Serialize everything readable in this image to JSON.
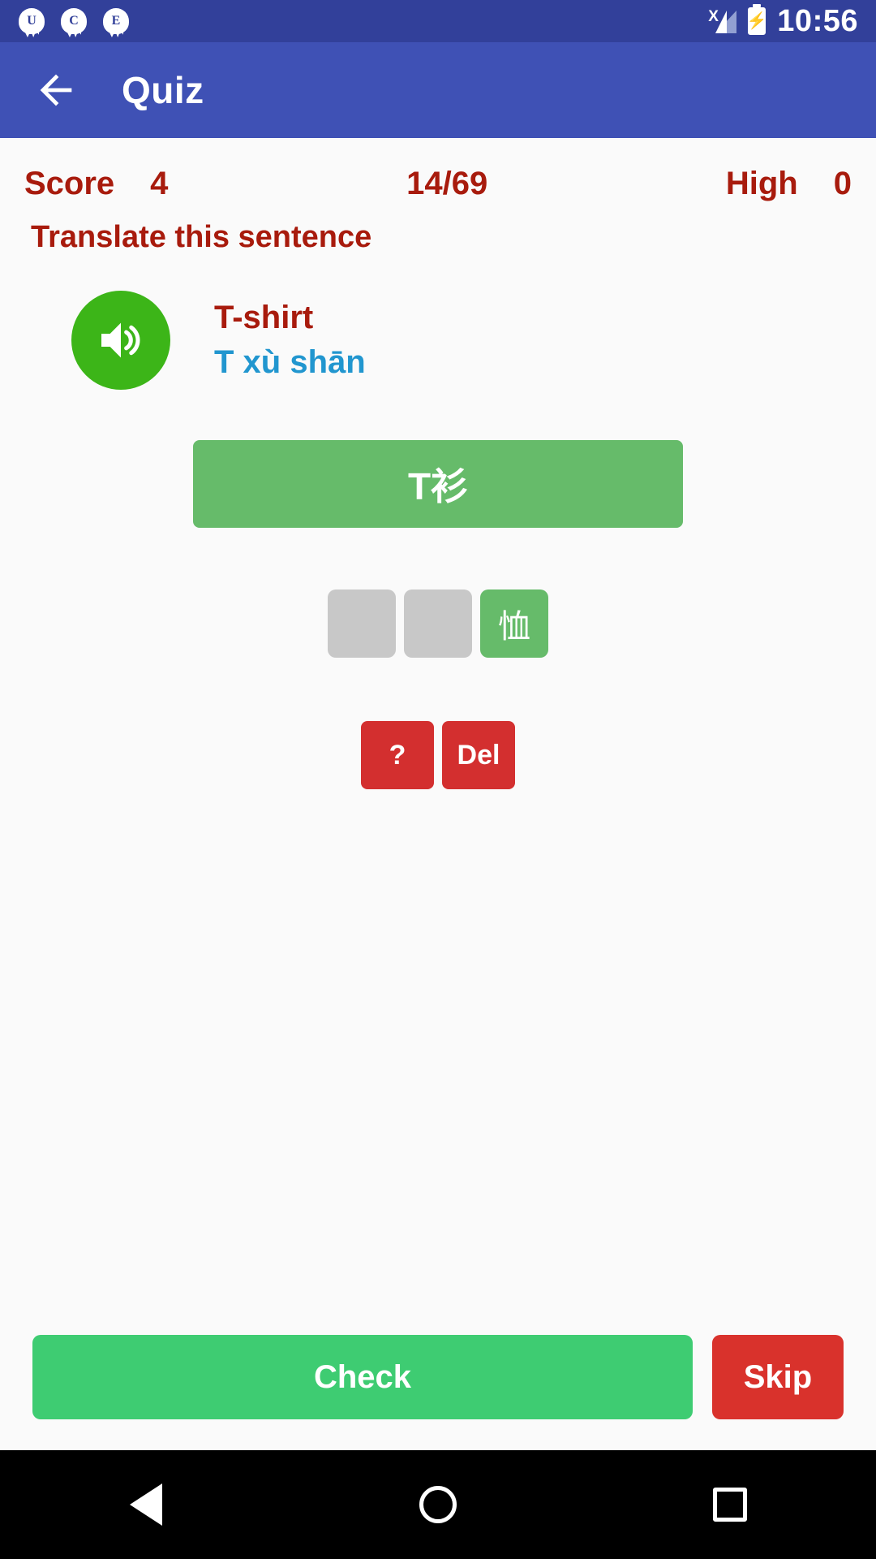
{
  "statusbar": {
    "notifications": [
      {
        "icon": "notification-bubble-icon",
        "letter": "U"
      },
      {
        "icon": "notification-bubble-icon",
        "letter": "C"
      },
      {
        "icon": "notification-bubble-icon",
        "letter": "E"
      }
    ],
    "signal_icon": "signal-no-service-icon",
    "signal_mark": "X",
    "battery_icon": "battery-charging-icon",
    "battery_glyph": "⚡",
    "time": "10:56"
  },
  "appbar": {
    "back_icon": "back-arrow-icon",
    "title": "Quiz"
  },
  "scorebar": {
    "score_label": "Score",
    "score_value": "4",
    "progress": "14/69",
    "high_label": "High",
    "high_value": "0"
  },
  "prompt": "Translate this sentence",
  "question": {
    "speaker_icon": "speaker-volume-icon",
    "word_en": "T-shirt",
    "word_pinyin": "T xù shān"
  },
  "answer_bar": {
    "text": "T衫"
  },
  "tiles": [
    {
      "state": "empty",
      "char": ""
    },
    {
      "state": "empty",
      "char": ""
    },
    {
      "state": "filled",
      "char": "恤"
    }
  ],
  "controls": {
    "hint_label": "?",
    "delete_label": "Del"
  },
  "actions": {
    "check_label": "Check",
    "skip_label": "Skip"
  },
  "navbar": {
    "back_icon": "nav-back-triangle-icon",
    "home_icon": "nav-home-circle-icon",
    "recent_icon": "nav-recents-square-icon"
  },
  "colors": {
    "status_bar": "#32409a",
    "app_bar": "#3f51b5",
    "accent_red": "#a81b0d",
    "pinyin_blue": "#2196cf",
    "speaker_green": "#3cb518",
    "answer_green": "#66bb6a",
    "check_green": "#3ecc72",
    "danger_red": "#d32f2f",
    "tile_gray": "#c8c8c8"
  }
}
